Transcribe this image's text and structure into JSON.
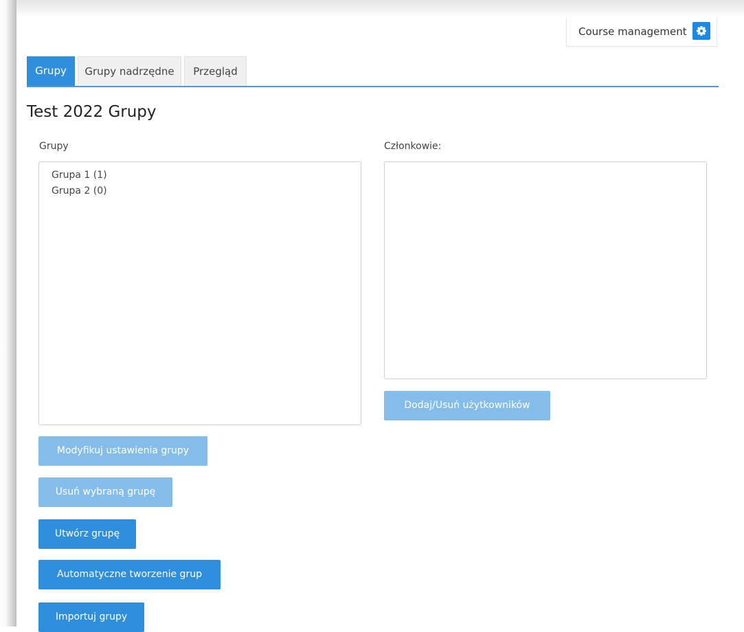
{
  "header": {
    "course_management_label": "Course management",
    "settings_icon": "gear-icon"
  },
  "tabs": [
    {
      "label": "Grupy",
      "active": true
    },
    {
      "label": "Grupy nadrzędne",
      "active": false
    },
    {
      "label": "Przegląd",
      "active": false
    }
  ],
  "page_title": "Test 2022 Grupy",
  "groups_panel": {
    "label": "Grupy",
    "items": [
      "Grupa 1 (1)",
      "Grupa 2 (0)"
    ]
  },
  "members_panel": {
    "label": "Członkowie:",
    "items": []
  },
  "buttons": {
    "add_remove_users": "Dodaj/Usuń użytkowników",
    "modify_group": "Modyfikuj ustawienia grupy",
    "delete_group": "Usuń wybraną grupę",
    "create_group": "Utwórz grupę",
    "auto_create": "Automatyczne tworzenie grup",
    "import_groups": "Importuj grupy"
  },
  "colors": {
    "accent": "#2f8fdc",
    "disabled_button": "#85bdea",
    "tab_underline": "#4a9bdc",
    "settings_icon_bg": "#1e88e5"
  }
}
